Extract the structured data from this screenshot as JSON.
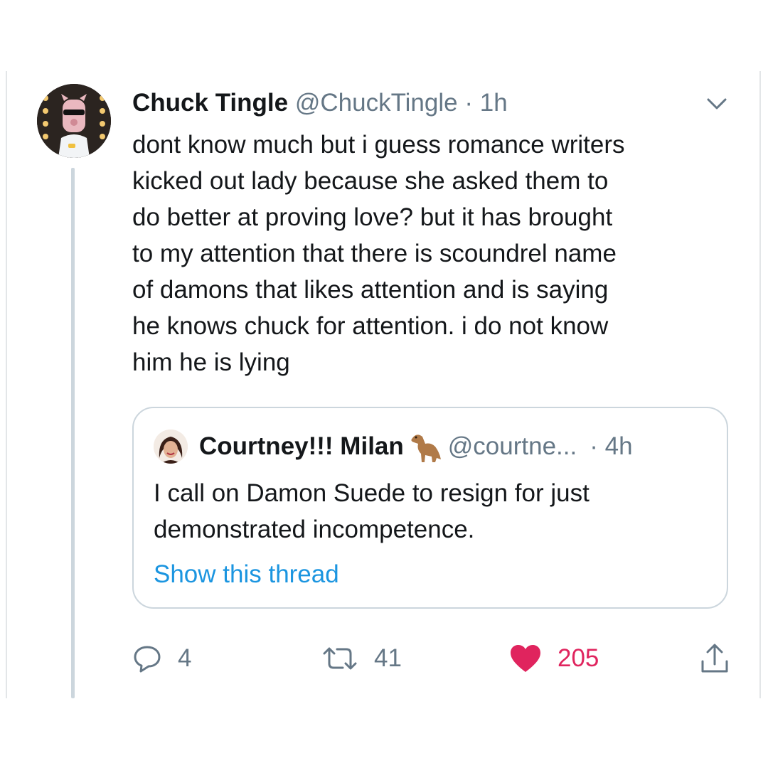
{
  "tweet": {
    "author_name": "Chuck Tingle",
    "author_handle": "@ChuckTingle",
    "separator": "·",
    "time": "1h",
    "text": "dont know much but i guess romance writers\nkicked out lady because she asked them to\ndo better at proving love? but it has brought\nto my attention that there is scoundrel name\nof damons that likes attention and is saying\nhe knows chuck for attention. i do not know\nhim he is lying",
    "avatar_icon": "avatar-image",
    "menu_icon": "chevron-down-icon"
  },
  "quoted_tweet": {
    "author_name": "Courtney!!! Milan",
    "emoji_icon": "dinosaur-emoji",
    "author_handle": "@courtne...",
    "time": "· 4h",
    "text": "I call on Damon Suede to resign for just\ndemonstrated incompetence.",
    "show_thread_label": "Show this thread"
  },
  "actions": {
    "replies": "4",
    "retweets": "41",
    "likes": "205",
    "reply_icon": "reply-icon",
    "retweet_icon": "retweet-icon",
    "like_icon": "heart-icon",
    "share_icon": "share-icon"
  },
  "colors": {
    "text": "#14171a",
    "secondary": "#657786",
    "link": "#1b95e0",
    "like": "#e0245e",
    "border": "#ccd6dd"
  }
}
